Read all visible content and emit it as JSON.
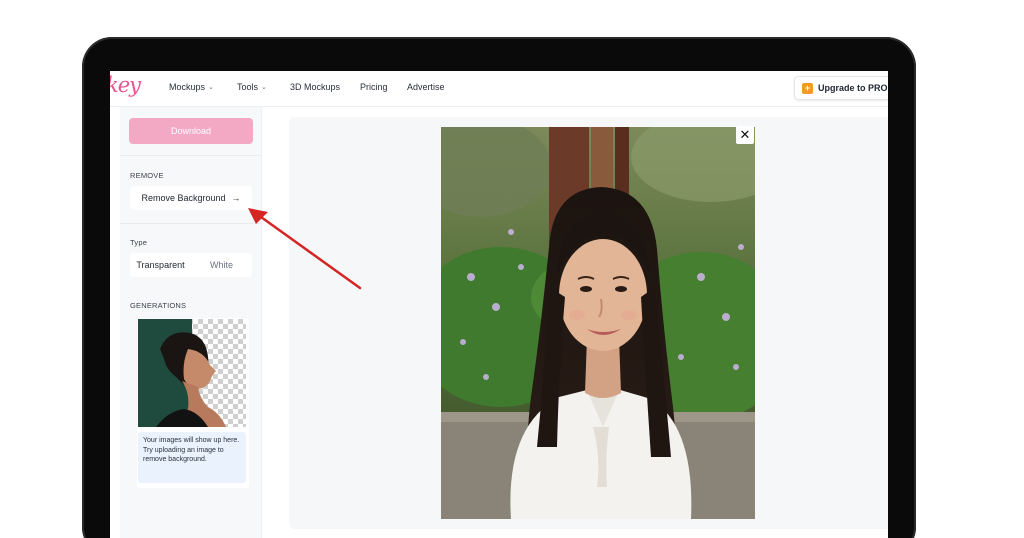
{
  "nav": {
    "logo": "key",
    "items": [
      {
        "label": "Mockups",
        "has_dropdown": true
      },
      {
        "label": "Tools",
        "has_dropdown": true
      },
      {
        "label": "3D Mockups",
        "has_dropdown": false
      },
      {
        "label": "Pricing",
        "has_dropdown": false
      },
      {
        "label": "Advertise",
        "has_dropdown": false
      }
    ],
    "upgrade_label": "Upgrade to PRO",
    "upgrade_icon": "plus-icon"
  },
  "sidebar": {
    "download_label": "Download",
    "remove_section_label": "REMOVE",
    "remove_button_label": "Remove Background",
    "remove_button_icon": "arrow-right-icon",
    "type_section_label": "Type",
    "type_options": [
      "Transparent",
      "White"
    ],
    "type_selected": "Transparent",
    "generations_label": "GENERATIONS",
    "generations_note": "Your images will show up here. Try uploading an image to remove background."
  },
  "main": {
    "close_icon": "close-icon"
  },
  "colors": {
    "brand_pink": "#e8558f",
    "download_button": "#f3a9c4",
    "annotation_arrow": "#d42424",
    "upgrade_icon": "#f59a2a"
  }
}
